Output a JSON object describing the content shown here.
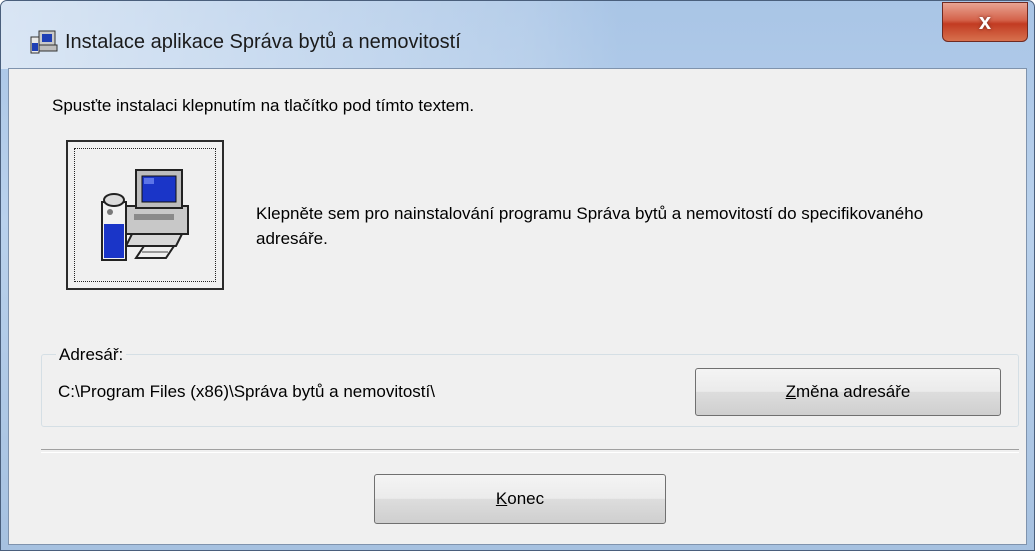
{
  "window": {
    "title": "Instalace aplikace Správa bytů a nemovitostí",
    "close_glyph": "x"
  },
  "content": {
    "instruction": "Spusťte instalaci klepnutím na tlačítko pod tímto textem.",
    "install_description": "Klepněte sem pro nainstalování programu Správa bytů a nemovitostí do specifikovaného adresáře."
  },
  "directory": {
    "group_label": "Adresář:",
    "path": "C:\\Program Files (x86)\\Správa bytů a nemovitostí\\",
    "change_button_accel": "Z",
    "change_button_rest": "měna adresáře"
  },
  "footer": {
    "close_button_accel": "K",
    "close_button_rest": "onec"
  },
  "icons": {
    "app": "installer-computer-icon",
    "install": "installer-computer-icon",
    "close": "close-icon"
  }
}
